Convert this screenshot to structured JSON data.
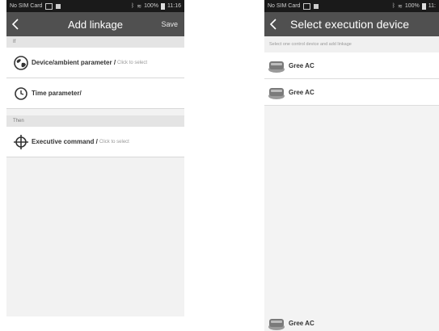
{
  "left": {
    "status": {
      "carrier": "No SIM Card",
      "battery": "100%",
      "time": "11:16"
    },
    "header": {
      "title": "Add linkage",
      "save": "Save"
    },
    "if_label": "If",
    "rows": [
      {
        "label": "Device/ambient parameter /",
        "hint": "Click to select"
      },
      {
        "label": "Time parameter/",
        "hint": ""
      }
    ],
    "then_label": "Then",
    "command": {
      "label": "Executive command /",
      "hint": "Click to select"
    }
  },
  "right": {
    "status": {
      "carrier": "No SIM Card",
      "battery": "100%",
      "time": "11:"
    },
    "header": {
      "title": "Select execution device"
    },
    "hint": "Select one control device and add linkage",
    "devices": [
      "Gree AC",
      "Gree AC"
    ],
    "bottom_device": "Gree AC"
  }
}
